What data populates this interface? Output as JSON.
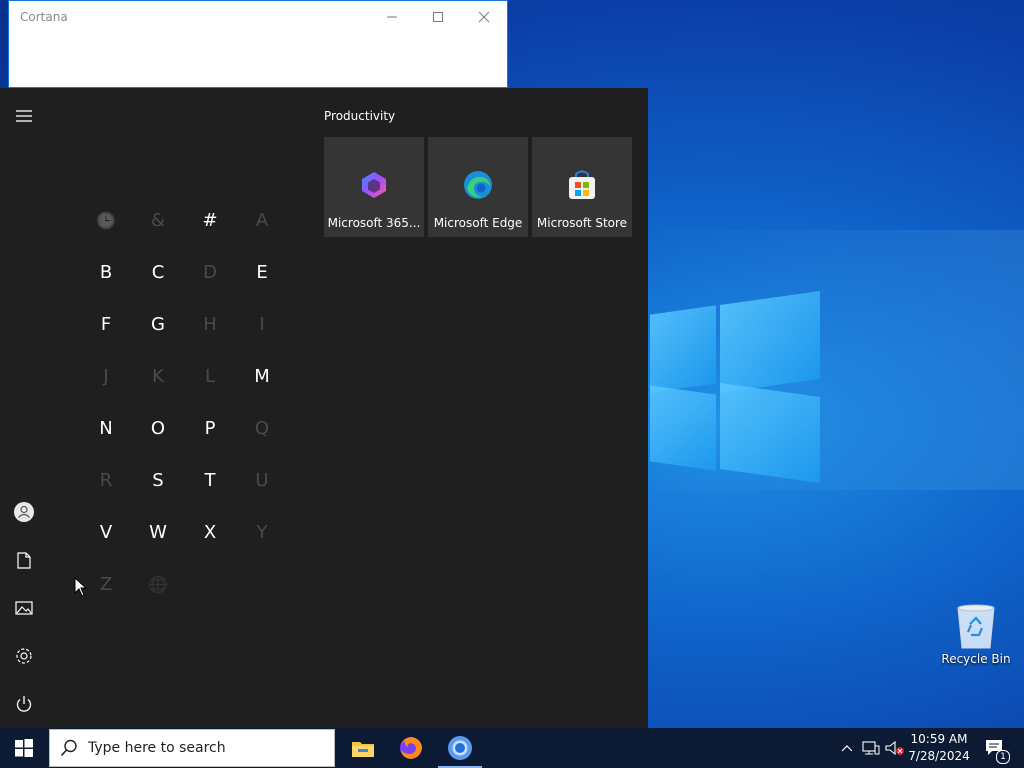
{
  "cortana": {
    "title": "Cortana"
  },
  "start_menu": {
    "letters": [
      {
        "char": "🕒",
        "active": false,
        "kind": "icon"
      },
      {
        "char": "&",
        "active": false
      },
      {
        "char": "#",
        "active": true
      },
      {
        "char": "A",
        "active": false
      },
      {
        "char": "B",
        "active": true
      },
      {
        "char": "C",
        "active": true
      },
      {
        "char": "D",
        "active": false
      },
      {
        "char": "E",
        "active": true
      },
      {
        "char": "F",
        "active": true
      },
      {
        "char": "G",
        "active": true
      },
      {
        "char": "H",
        "active": false
      },
      {
        "char": "I",
        "active": false
      },
      {
        "char": "J",
        "active": false
      },
      {
        "char": "K",
        "active": false
      },
      {
        "char": "L",
        "active": false
      },
      {
        "char": "M",
        "active": true
      },
      {
        "char": "N",
        "active": true
      },
      {
        "char": "O",
        "active": true
      },
      {
        "char": "P",
        "active": true
      },
      {
        "char": "Q",
        "active": false
      },
      {
        "char": "R",
        "active": false
      },
      {
        "char": "S",
        "active": true
      },
      {
        "char": "T",
        "active": true
      },
      {
        "char": "U",
        "active": false
      },
      {
        "char": "V",
        "active": true
      },
      {
        "char": "W",
        "active": true
      },
      {
        "char": "X",
        "active": true
      },
      {
        "char": "Y",
        "active": false
      },
      {
        "char": "Z",
        "active": false
      },
      {
        "char": "🌐",
        "active": false,
        "kind": "icon"
      }
    ],
    "tiles_section_title": "Productivity",
    "tiles": [
      {
        "label": "Microsoft 365...",
        "icon": "microsoft-365-icon"
      },
      {
        "label": "Microsoft Edge",
        "icon": "edge-icon"
      },
      {
        "label": "Microsoft Store",
        "icon": "store-icon"
      }
    ],
    "rail_icons": [
      "hamburger-menu-icon",
      "user-icon",
      "documents-icon",
      "pictures-icon",
      "settings-icon",
      "power-icon"
    ]
  },
  "desktop": {
    "recycle_bin_label": "Recycle Bin"
  },
  "taskbar": {
    "search_placeholder": "Type here to search",
    "apps": [
      "file-explorer-icon",
      "firefox-icon",
      "chrome-icon"
    ],
    "time": "10:59 AM",
    "date": "7/28/2024",
    "notification_count": "1"
  },
  "colors": {
    "accent": "#0f63c9",
    "start_bg": "#1f1f1f",
    "tile_bg": "#353535",
    "taskbar_bg": "#0c1a33"
  }
}
